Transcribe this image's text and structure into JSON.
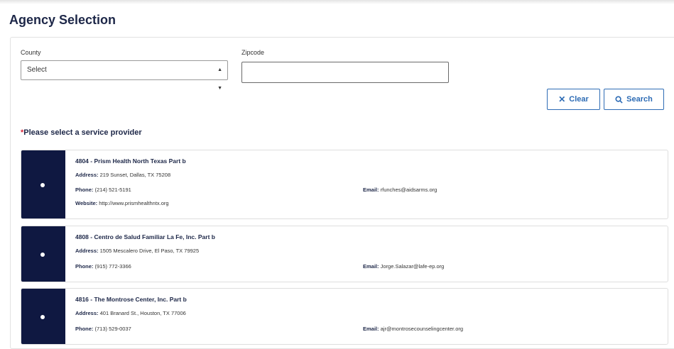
{
  "page": {
    "title": "Agency Selection"
  },
  "filters": {
    "county_label": "County",
    "county_value": "Select",
    "zip_label": "Zipcode",
    "zip_value": ""
  },
  "actions": {
    "clear_label": "Clear",
    "search_label": "Search"
  },
  "providers_section": {
    "required_mark": "*",
    "label": "Please select a service provider"
  },
  "labels": {
    "address": "Address:",
    "phone": "Phone:",
    "email": "Email:",
    "website": "Website:"
  },
  "providers": [
    {
      "name": "4804 - Prism Health North Texas Part b",
      "address": "219 Sunset, Dallas, TX 75208",
      "phone": "(214) 521-5191",
      "email": "rfunches@aidsarms.org",
      "website": "http://www.prismhealthntx.org"
    },
    {
      "name": "4808 - Centro de Salud Familiar La Fe, Inc. Part b",
      "address": "1505 Mescalero Drive, El Paso, TX 79925",
      "phone": "(915) 772-3366",
      "email": "Jorge.Salazar@lafe-ep.org"
    },
    {
      "name": "4816 - The Montrose Center, Inc. Part b",
      "address": "401 Branard St., Houston, TX 77006",
      "phone": "(713) 529-0037",
      "email": "ajr@montrosecounselingcenter.org"
    }
  ],
  "colors": {
    "accent": "#2e6cb5",
    "navy": "#0f1841",
    "required": "#d9263b"
  },
  "icons": {
    "clear": "close-icon",
    "search": "search-icon",
    "select": "chevron-updown-icon"
  }
}
